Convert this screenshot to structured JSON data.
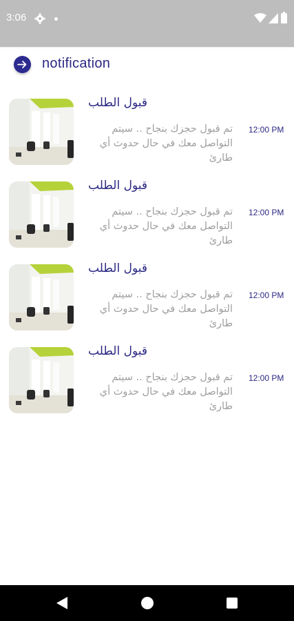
{
  "status_bar": {
    "time": "3:06",
    "icons": [
      "gear-icon",
      "dot-icon",
      "wifi-icon",
      "signal-icon",
      "battery-icon"
    ]
  },
  "header": {
    "title": "notification",
    "back_icon": "arrow-right-circle-icon"
  },
  "notifications": [
    {
      "title": "قبول الطلب",
      "body": "تم قبول حجزك بنجاح .. سيتم التواصل معك في حال حدوث أي طارئ",
      "time": "12:00 PM",
      "thumbnail": "salon-interior-image"
    },
    {
      "title": "قبول الطلب",
      "body": "تم قبول حجزك بنجاح .. سيتم التواصل معك في حال حدوث أي طارئ",
      "time": "12:00 PM",
      "thumbnail": "salon-interior-image"
    },
    {
      "title": "قبول الطلب",
      "body": "تم قبول حجزك بنجاح .. سيتم التواصل معك في حال حدوث أي طارئ",
      "time": "12:00 PM",
      "thumbnail": "salon-interior-image"
    },
    {
      "title": "قبول الطلب",
      "body": "تم قبول حجزك بنجاح .. سيتم التواصل معك في حال حدوث أي طارئ",
      "time": "12:00 PM",
      "thumbnail": "salon-interior-image"
    }
  ],
  "nav_bar": {
    "icons": [
      "nav-back-icon",
      "nav-home-icon",
      "nav-recents-icon"
    ]
  },
  "colors": {
    "accent": "#2b2882",
    "status_bar": "#bdbdbd",
    "body_text": "#9e9e9e"
  }
}
